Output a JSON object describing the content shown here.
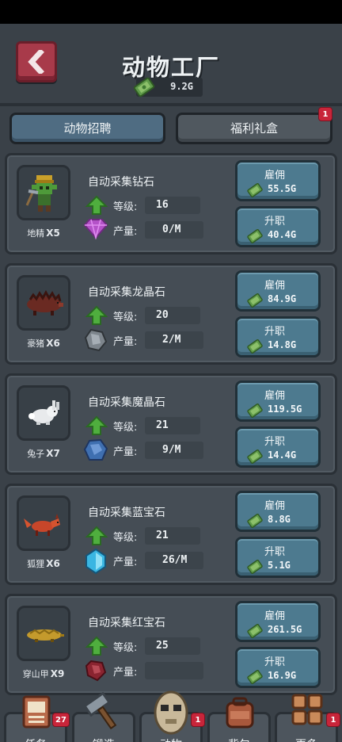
{
  "header": {
    "title": "动物工厂",
    "currency": "9.2G"
  },
  "tabs": [
    {
      "label": "动物招聘",
      "active": true
    },
    {
      "label": "福利礼盒",
      "active": false,
      "badge": "1"
    }
  ],
  "labels": {
    "level": "等级:",
    "production": "产量:",
    "hire": "雇佣",
    "promote": "升职"
  },
  "animals": [
    {
      "name": "地精",
      "count": "X5",
      "task": "自动采集钻石",
      "level": "16",
      "production": "0/M",
      "hire_cost": "55.5G",
      "promote_cost": "40.4G",
      "resource_icon": "diamond-icon"
    },
    {
      "name": "豪猪",
      "count": "X6",
      "task": "自动采集龙晶石",
      "level": "20",
      "production": "2/M",
      "hire_cost": "84.9G",
      "promote_cost": "14.8G",
      "resource_icon": "dragon-crystal-icon"
    },
    {
      "name": "兔子",
      "count": "X7",
      "task": "自动采集魔晶石",
      "level": "21",
      "production": "9/M",
      "hire_cost": "119.5G",
      "promote_cost": "14.4G",
      "resource_icon": "magic-crystal-icon"
    },
    {
      "name": "狐狸",
      "count": "X6",
      "task": "自动采集蓝宝石",
      "level": "21",
      "production": "26/M",
      "hire_cost": "8.8G",
      "promote_cost": "5.1G",
      "resource_icon": "sapphire-icon"
    },
    {
      "name": "穿山甲",
      "count": "X9",
      "task": "自动采集红宝石",
      "level": "25",
      "production": "",
      "hire_cost": "261.5G",
      "promote_cost": "16.9G",
      "resource_icon": "ruby-icon"
    }
  ],
  "nav": [
    {
      "label": "任务",
      "badge": "27",
      "icon": "quest-icon"
    },
    {
      "label": "锻造",
      "badge": "",
      "icon": "hammer-icon"
    },
    {
      "label": "动物",
      "badge": "1",
      "icon": "animal-icon"
    },
    {
      "label": "背包",
      "badge": "",
      "icon": "backpack-icon"
    },
    {
      "label": "更多",
      "badge": "1",
      "icon": "more-icon"
    }
  ]
}
